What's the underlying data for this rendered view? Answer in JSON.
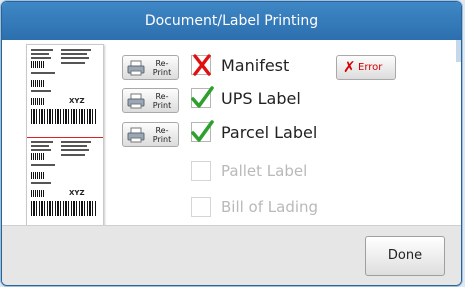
{
  "dialog": {
    "title": "Document/Label Printing"
  },
  "items": [
    {
      "label": "Manifest",
      "reprint_label": "Re-\nPrint",
      "state": "error",
      "enabled": true
    },
    {
      "label": "UPS Label",
      "reprint_label": "Re-\nPrint",
      "state": "checked",
      "enabled": true
    },
    {
      "label": "Parcel Label",
      "reprint_label": "Re-\nPrint",
      "state": "checked",
      "enabled": true
    },
    {
      "label": "Pallet Label",
      "state": "unchecked",
      "enabled": false
    },
    {
      "label": "Bill of Lading",
      "state": "unchecked",
      "enabled": false
    }
  ],
  "error_button": {
    "label": "Error"
  },
  "footer": {
    "done_label": "Done"
  },
  "preview": {
    "text1": "XYZ",
    "text2": "XYZ"
  },
  "colors": {
    "title_bar": "#3479ba",
    "error": "#d40000",
    "check_green": "#2ea02e",
    "x_red": "#e01010"
  }
}
